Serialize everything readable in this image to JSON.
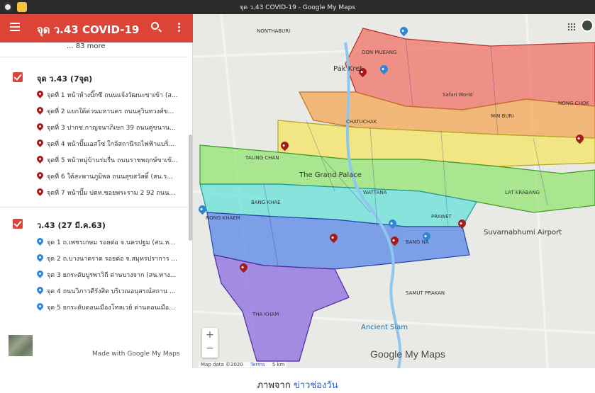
{
  "window": {
    "title": "จุด ว.43 COVID-19 - Google My Maps"
  },
  "panel": {
    "title": "จุด ว.43 COVID-19",
    "more_text": "... 83 more",
    "layers": [
      {
        "name": "จุด ว.43 (7จุด)",
        "items": [
          "จุดที่ 1 หน้าห้างบิ๊กซี ถนนแจ้งวัฒนะขาเข้า (ส...",
          "จุดที่ 2 แยกใต้ด่วนมหานคร ถนนสุวินทวงศ์ข...",
          "จุดที่ 3 ปากซ.กาญจนาภิเษก 39 ถนนคู่ขนาน...",
          "จุดที่ 4 หน้าปั๊มเอสโซ่ ใกล้สถานีรถไฟฟ้าแบริ่...",
          "จุดที่ 5 หน้าหมู่บ้านร่มรื่น ถนนราชพฤกษ์ขาเข้...",
          "จุดที่ 6 ใต้สะพานภูมิพล ถนนสุขสวัสดิ์ (สน.ร...",
          "จุดที่ 7 หน้าปั๊ม ปตท.ซอยพระราม 2 92 ถนน..."
        ]
      },
      {
        "name": "ว.43 (27 มี.ค.63)",
        "items": [
          "จุด 1 ถ.เพชรเกษม รอยต่อ จ.นครปฐม (สน.ห...",
          "จุด 2 ถ.บางนาตราด รอยต่อ จ.สมุทรปราการ ...",
          "จุด 3 ยกระดับบูรพาวิถี ด่านบางจาก (สน.ทาง...",
          "จุด 4 ถนนวิภาวดีรังสิต บริเวณอนุสรณ์สถาน ...",
          "จุด 5 ยกระดับดอนเมืองโทลเวย์ ด่านดอนเมือ..."
        ]
      }
    ],
    "footer": "Made with Google My Maps"
  },
  "map": {
    "zoom_in": "+",
    "zoom_out": "−",
    "attribution": "Map data ©2020",
    "terms": "Terms",
    "scale": "5 km",
    "logo": "Google My Maps",
    "labels": {
      "don_mueang": "DON MUEANG",
      "pak_kret": "Pak Kret",
      "safari": "Safari World",
      "min_buri": "MIN BURI",
      "nong_chok": "NONG CHOK",
      "lat_krabang": "LAT KRABANG",
      "grand_palace": "The Grand Palace",
      "suvarnabhumi": "Suvarnabhumi Airport",
      "samut_prakan": "SAMUT PRAKAN",
      "ancient_siam": "Ancient Siam",
      "bang_khae": "BANG KHAE",
      "taling_chan": "TALING CHAN",
      "chatuchak": "CHATUCHAK",
      "nong_khaem": "NONG KHAEM",
      "tha_kham": "THA KHAM",
      "prawet": "PRAWET",
      "wattana": "WATTANA",
      "bang_na": "BANG NA",
      "nonthaburi": "NONTHABURI"
    }
  },
  "caption": {
    "prefix": "ภาพจาก",
    "link": "ข่าวช่องวัน"
  },
  "colors": {
    "appbar": "#db4437",
    "pin_red": "#a51c1c",
    "pin_blue": "#2d87d6"
  }
}
